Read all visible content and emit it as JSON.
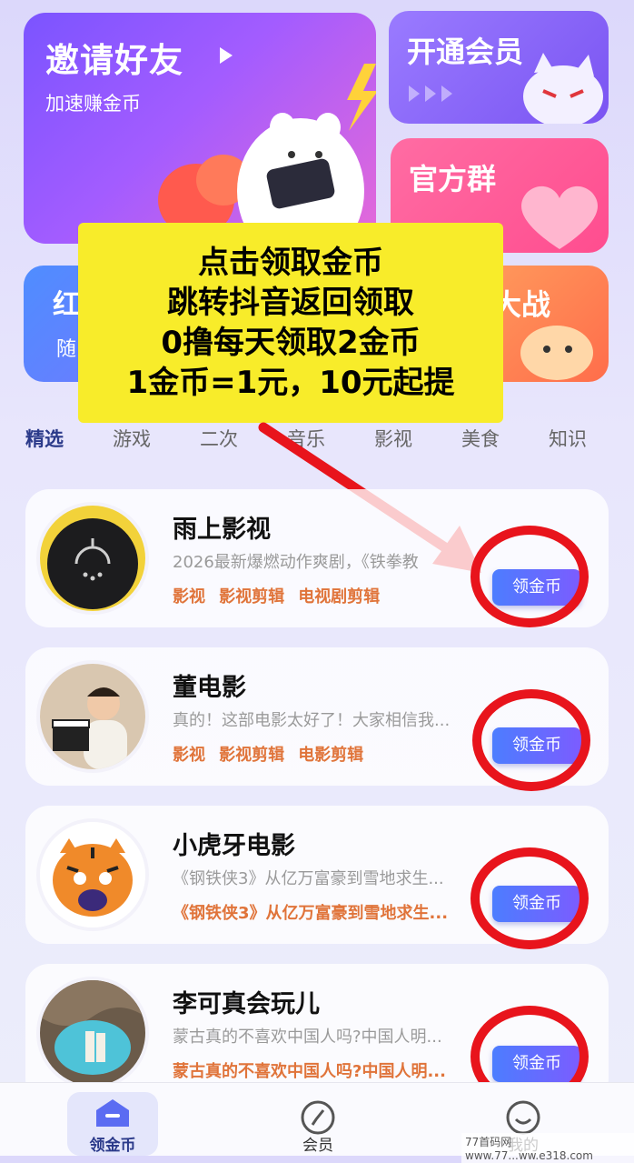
{
  "banner": {
    "invite_title": "邀请好友",
    "invite_subtitle": "加速赚金币",
    "vip": "开通会员",
    "group": "官方群",
    "red_partial": "红",
    "red_sub_partial": "随",
    "war_partial": "大战"
  },
  "overlay": {
    "lines": [
      "点击领取金币",
      "跳转抖音返回领取",
      "0撸每天领取2金币",
      "1金币=1元，10元起提"
    ]
  },
  "tabs": [
    "精选",
    "游戏",
    "二次",
    "音乐",
    "影视",
    "美食",
    "知识"
  ],
  "items": [
    {
      "name": "雨上影视",
      "desc": "2026最新爆燃动作爽剧，《铁拳教",
      "tags": [
        "影视",
        "影视剪辑",
        "电视剧剪辑"
      ],
      "button": "领金币"
    },
    {
      "name": "董电影",
      "desc": "真的！这部电影太好了！大家相信我...",
      "tags": [
        "影视",
        "影视剪辑",
        "电影剪辑"
      ],
      "button": "领金币"
    },
    {
      "name": "小虎牙电影",
      "desc": "《钢铁侠3》从亿万富豪到雪地求生...",
      "tags": [
        "《钢铁侠3》从亿万富豪到雪地求生..."
      ],
      "button": "领金币"
    },
    {
      "name": "李可真会玩儿",
      "desc": "蒙古真的不喜欢中国人吗?中国人明...",
      "tags": [
        "蒙古真的不喜欢中国人吗?中国人明..."
      ],
      "button": "领金币"
    }
  ],
  "nav": {
    "tab1": "领金币",
    "tab2": "会员",
    "tab3": "我的"
  },
  "watermark": "77首码网 www.77...ww.e318.com",
  "colors": {
    "accent": "#7c5cff",
    "highlight": "#f8ec2a",
    "annotation": "#e8141c",
    "tag": "#e0743a"
  }
}
